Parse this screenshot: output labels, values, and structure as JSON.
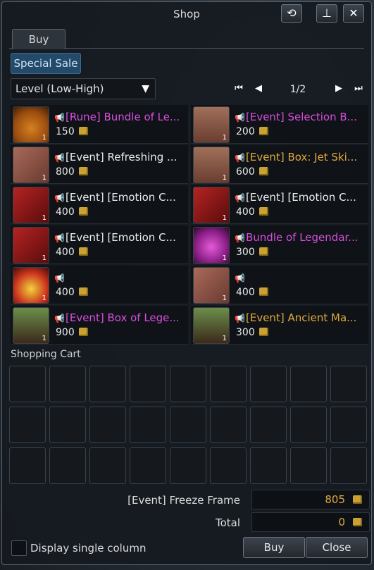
{
  "window": {
    "title": "Shop",
    "buttons": [
      "refresh-icon",
      "minimize-icon",
      "close-icon"
    ]
  },
  "tabs": [
    {
      "label": "Buy",
      "active": true
    }
  ],
  "category": {
    "label": "Special Sale",
    "active": true
  },
  "sort": {
    "selected": "Level (Low-High)"
  },
  "pagination": {
    "current": "1/2"
  },
  "items": [
    {
      "name": "[Rune] Bundle of Le...",
      "price": "150",
      "rarity": "magenta",
      "icon": "pouch-icon",
      "qty": "1"
    },
    {
      "name": "[Event] Selection B...",
      "price": "200",
      "rarity": "magenta",
      "icon": "chest-icon",
      "qty": "1"
    },
    {
      "name": "[Event] Refreshing ...",
      "price": "800",
      "rarity": "white",
      "icon": "crate-icon",
      "qty": "1"
    },
    {
      "name": "[Event] Box: Jet Ski...",
      "price": "600",
      "rarity": "orange",
      "icon": "chest-icon",
      "qty": "1"
    },
    {
      "name": "[Event] [Emotion C...",
      "price": "400",
      "rarity": "white",
      "icon": "emotion-card-icon",
      "qty": "1"
    },
    {
      "name": "[Event] [Emotion C...",
      "price": "400",
      "rarity": "white",
      "icon": "emotion-card-icon",
      "qty": "1"
    },
    {
      "name": "[Event] [Emotion C...",
      "price": "400",
      "rarity": "white",
      "icon": "emotion-card-icon",
      "qty": "1"
    },
    {
      "name": "Bundle of Legendar...",
      "price": "300",
      "rarity": "magenta",
      "icon": "pouch-icon",
      "qty": "1"
    },
    {
      "name": "",
      "price": "400",
      "rarity": "magenta",
      "icon": "pouch-icon",
      "qty": "1"
    },
    {
      "name": "",
      "price": "400",
      "rarity": "orange",
      "icon": "crate-icon",
      "qty": "1"
    },
    {
      "name": "[Event] Box of Lege...",
      "price": "900",
      "rarity": "magenta",
      "icon": "treasure-chest-icon",
      "qty": "1"
    },
    {
      "name": "[Event] Ancient Ma...",
      "price": "300",
      "rarity": "orange",
      "icon": "treasure-chest-icon",
      "qty": "1"
    }
  ],
  "cart": {
    "label": "Shopping Cart",
    "rows": 3,
    "cols": 9
  },
  "summary": {
    "item_label": "[Event] Freeze Frame",
    "item_value": "805",
    "total_label": "Total",
    "total_value": "0"
  },
  "footer": {
    "checkbox_label": "Display single column",
    "checkbox_checked": false,
    "buy_label": "Buy",
    "close_label": "Close"
  },
  "colors": {
    "magenta": "#d94de0",
    "orange": "#e1a93d",
    "white": "#ececec"
  }
}
